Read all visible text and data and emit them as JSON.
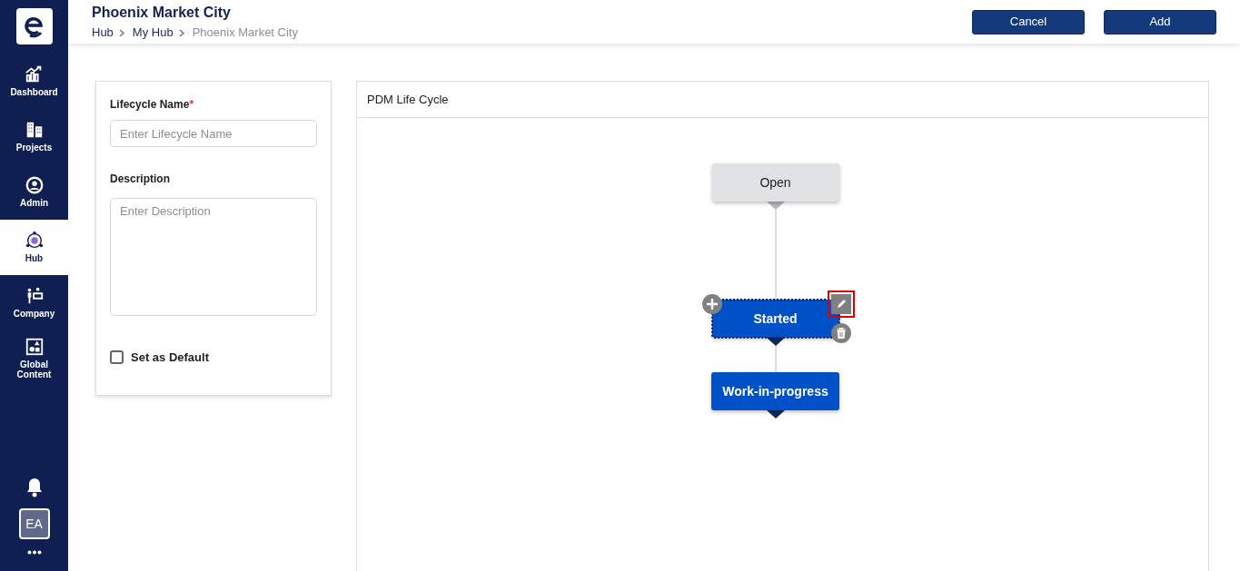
{
  "sidebar": {
    "items": [
      {
        "label": "Dashboard",
        "selected": false
      },
      {
        "label": "Projects",
        "selected": false
      },
      {
        "label": "Admin",
        "selected": false
      },
      {
        "label": "Hub",
        "selected": true
      },
      {
        "label": "Company",
        "selected": false
      },
      {
        "label": "Global Content",
        "selected": false
      }
    ],
    "avatar": "EA"
  },
  "header": {
    "title": "Phoenix Market City",
    "breadcrumb": [
      "Hub",
      "My Hub",
      "Phoenix Market City"
    ],
    "buttons": [
      "Cancel",
      "Add"
    ]
  },
  "form": {
    "name_label": "Lifecycle Name",
    "required_mark": "*",
    "name_placeholder": "Enter Lifecycle Name",
    "description_label": "Description",
    "description_placeholder": "Enter Description",
    "default_label": "Set as Default",
    "default_checked": false
  },
  "lifecycle": {
    "title": "PDM Life Cycle",
    "stages": [
      {
        "label": "Open",
        "kind": "fixed",
        "selected": false
      },
      {
        "label": "Started",
        "kind": "status",
        "selected": true,
        "edit_highlighted": true
      },
      {
        "label": "Work-in-progress",
        "kind": "status",
        "selected": false
      }
    ]
  }
}
